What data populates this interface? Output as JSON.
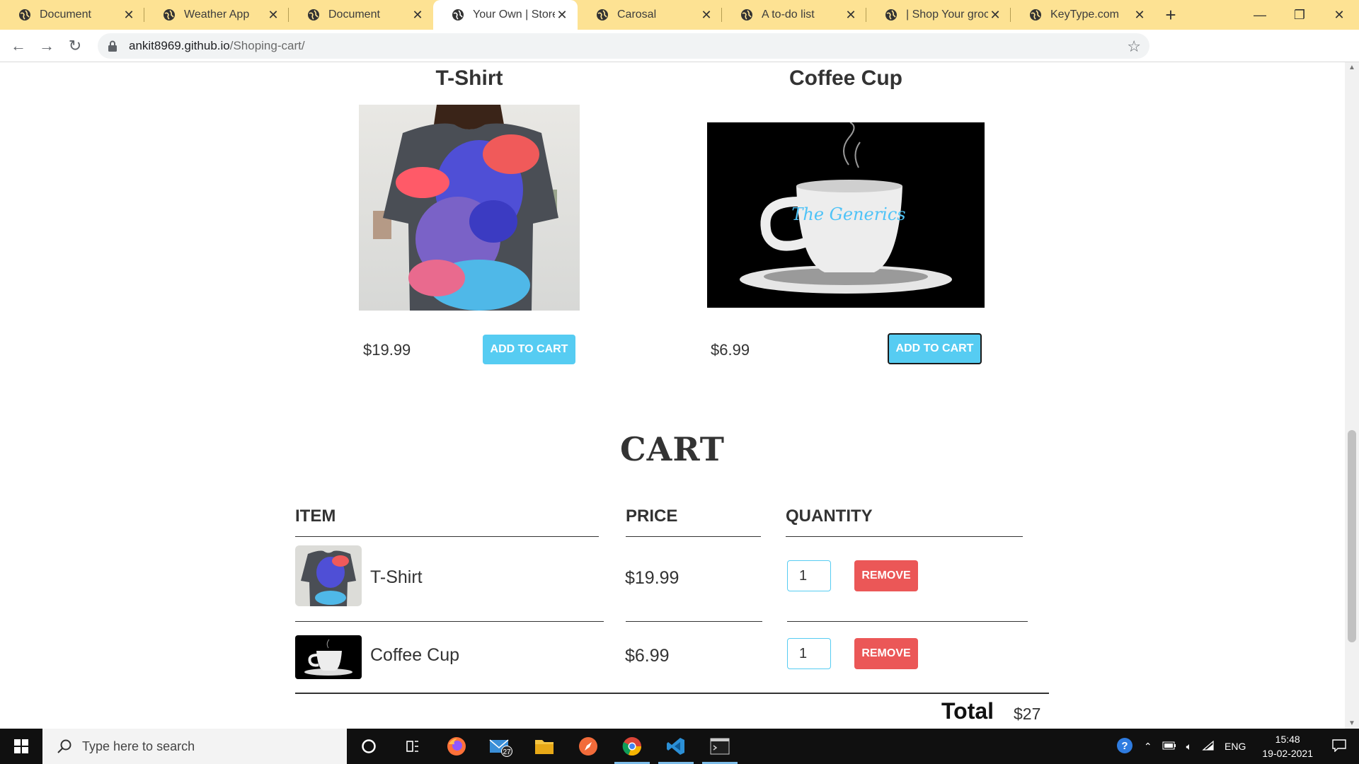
{
  "browser": {
    "tabs": [
      {
        "title": "Document",
        "active": false
      },
      {
        "title": "Weather App",
        "active": false
      },
      {
        "title": "Document",
        "active": false
      },
      {
        "title": "Your Own | Store",
        "active": true
      },
      {
        "title": "Carosal",
        "active": false
      },
      {
        "title": "A to-do list",
        "active": false
      },
      {
        "title": "| Shop Your grocer",
        "active": false
      },
      {
        "title": "KeyType.com",
        "active": false
      }
    ],
    "url_host": "ankit8969.github.io",
    "url_path": "/Shoping-cart/"
  },
  "store": {
    "items": [
      {
        "title": "T-Shirt",
        "price": "$19.99",
        "button": "ADD TO CART"
      },
      {
        "title": "Coffee Cup",
        "price": "$6.99",
        "button": "ADD TO CART",
        "mug_text": "The Generics"
      }
    ]
  },
  "cart": {
    "title": "CART",
    "columns": {
      "item": "ITEM",
      "price": "PRICE",
      "quantity": "QUANTITY"
    },
    "rows": [
      {
        "name": "T-Shirt",
        "price": "$19.99",
        "quantity": "1",
        "remove": "REMOVE"
      },
      {
        "name": "Coffee Cup",
        "price": "$6.99",
        "quantity": "1",
        "remove": "REMOVE"
      }
    ],
    "total_label": "Total",
    "total_value": "$27"
  },
  "taskbar": {
    "search_placeholder": "Type here to search",
    "mail_badge": "27",
    "lang": "ENG",
    "time": "15:48",
    "date": "19-02-2021"
  },
  "colors": {
    "accent": "#56ccf2",
    "danger": "#eb5757",
    "tabbar": "#fde293"
  }
}
